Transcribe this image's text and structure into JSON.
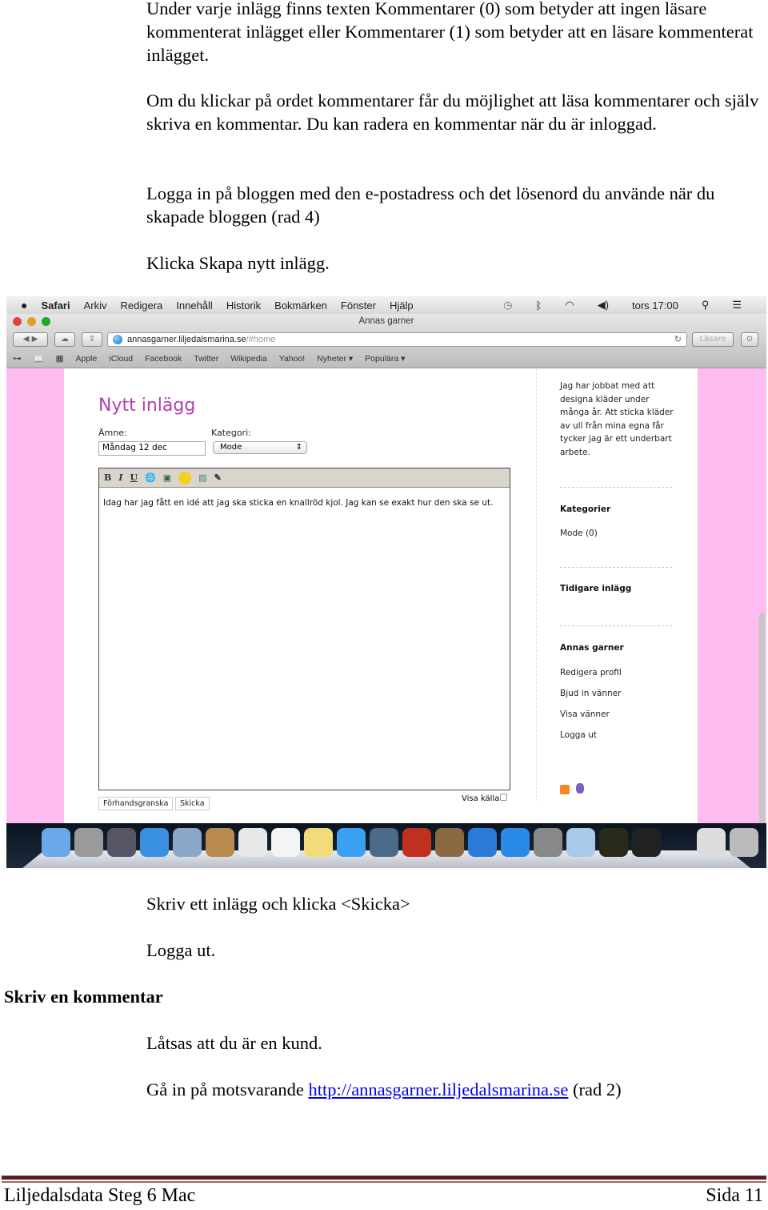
{
  "paragraphs_top": [
    "Under varje inlägg finns texten Kommentarer (0) som betyder att ingen läsare kommenterat inlägget eller Kommentarer (1) som betyder att en läsare kommenterat inlägget.",
    "Om du klickar på ordet kommentarer får du möjlighet att läsa kommentarer och själv skriva en kommentar. Du kan radera en kommentar när du är inloggad.",
    "Logga in på bloggen med den e-postadress och det lösenord du använde när du skapade bloggen (rad 4)",
    "Klicka Skapa nytt inlägg."
  ],
  "screenshot": {
    "menubar": {
      "items": [
        "Safari",
        "Arkiv",
        "Redigera",
        "Innehåll",
        "Historik",
        "Bokmärken",
        "Fönster",
        "Hjälp"
      ],
      "clock": "tors 17:00"
    },
    "window_title": "Annas garner",
    "url": {
      "host": "annasgarner.liljedalsmarina.se",
      "path": "/#home"
    },
    "reader_button": "Läsare",
    "bookmarks": [
      "Apple",
      "iCloud",
      "Facebook",
      "Twitter",
      "Wikipedia",
      "Yahoo!",
      "Nyheter ▾",
      "Populära ▾"
    ],
    "form": {
      "title": "Nytt inlägg",
      "subject_label": "Ämne:",
      "subject_value": "Måndag 12 dec",
      "category_label": "Kategori:",
      "category_value": "Mode",
      "toolbar": {
        "bold": "B",
        "italic": "I",
        "underline": "U"
      },
      "body": "Idag har jag fått en idé att jag ska sticka en knallröd kjol. Jag kan se exakt hur den ska se ut.",
      "preview_button": "Förhandsgranska",
      "send_button": "Skicka",
      "show_source": "Visa källa"
    },
    "sidebar": {
      "about": "Jag har jobbat med att designa kläder under många år. Att sticka kläder av ull från mina egna får tycker jag är ett underbart arbete.",
      "categories_heading": "Kategorier",
      "categories": [
        "Mode (0)"
      ],
      "earlier_heading": "Tidigare inlägg",
      "blog_heading": "Annas garner",
      "links": [
        "Redigera profil",
        "Bjud in vänner",
        "Visa vänner",
        "Logga ut"
      ]
    },
    "colors": {
      "page_bg": "#fcbcf0",
      "title": "#b13fae"
    },
    "dock_icons": [
      "finder",
      "launchpad",
      "mission-control",
      "safari",
      "mail",
      "contacts",
      "calendar",
      "reminders",
      "notes",
      "messages",
      "facetime",
      "photo-booth",
      "iphoto",
      "itunes",
      "app-store",
      "system-preferences",
      "textedit",
      "console",
      "terminal",
      "documents",
      "trash"
    ]
  },
  "paragraphs_bottom": [
    "Skriv ett inlägg och klicka <Skicka>",
    "Logga ut."
  ],
  "heading": "Skriv en kommentar",
  "paragraphs_after": [
    "Låtsas att du är en kund."
  ],
  "link_paragraph": {
    "before": "Gå in på motsvarande ",
    "link": "http://annasgarner.liljedalsmarina.se",
    "after": " (rad 2)"
  },
  "footer": {
    "left": "Liljedalsdata Steg 6 Mac",
    "right": "Sida 11"
  }
}
